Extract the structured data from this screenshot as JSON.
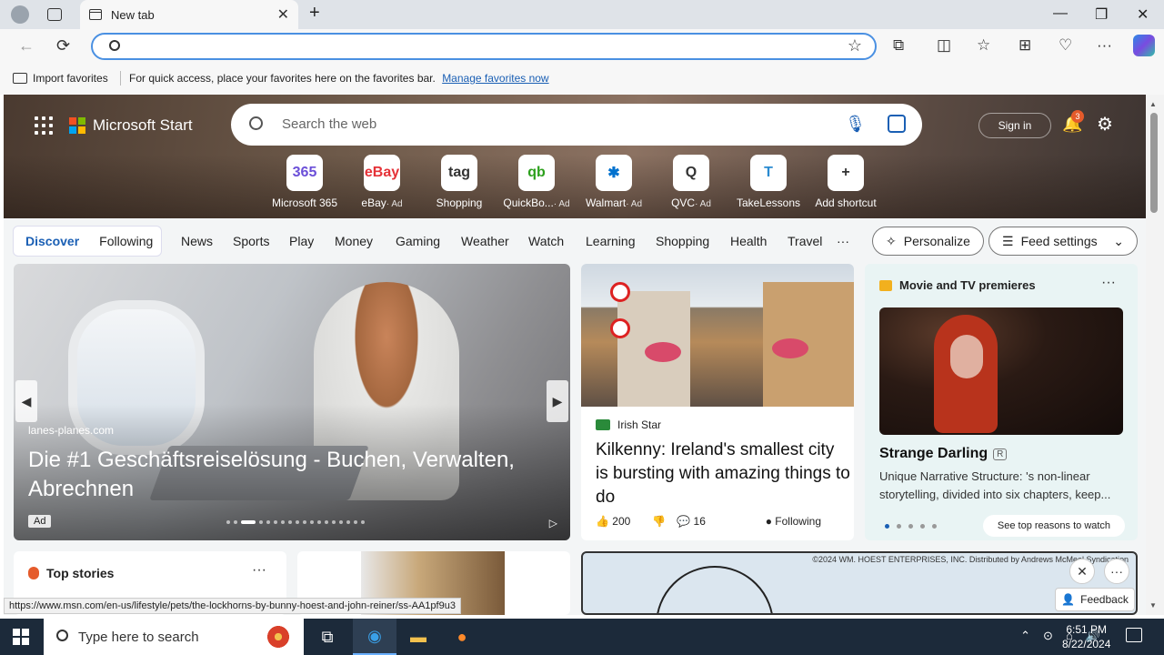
{
  "browser": {
    "tab_title": "New tab",
    "favbar": {
      "import_label": "Import favorites",
      "message": "For quick access, place your favorites here on the favorites bar.",
      "manage_link": "Manage favorites now"
    }
  },
  "header": {
    "brand": "Microsoft Start",
    "search_placeholder": "Search the web",
    "signin": "Sign in",
    "notification_count": "3"
  },
  "shortcuts": [
    {
      "label": "Microsoft 365",
      "ad": "",
      "icon": "365",
      "color": "#6b4fd8"
    },
    {
      "label": "eBay",
      "ad": "· Ad",
      "icon": "eBay",
      "color": "#e53238"
    },
    {
      "label": "Shopping",
      "ad": "",
      "icon": "tag",
      "color": "#333"
    },
    {
      "label": "QuickBo...",
      "ad": "· Ad",
      "icon": "qb",
      "color": "#2ca01c"
    },
    {
      "label": "Walmart",
      "ad": "· Ad",
      "icon": "✱",
      "color": "#0071ce"
    },
    {
      "label": "QVC",
      "ad": "· Ad",
      "icon": "Q",
      "color": "#333"
    },
    {
      "label": "TakeLessons",
      "ad": "",
      "icon": "T",
      "color": "#2a8ad0"
    },
    {
      "label": "Add shortcut",
      "ad": "",
      "icon": "+",
      "color": "#333"
    }
  ],
  "nav": {
    "discover": "Discover",
    "following": "Following",
    "items": [
      "News",
      "Sports",
      "Play",
      "Money",
      "Gaming",
      "Weather",
      "Watch",
      "Learning",
      "Shopping",
      "Health",
      "Travel",
      "···"
    ],
    "personalize": "Personalize",
    "feed_settings": "Feed settings"
  },
  "hero_card": {
    "source": "lanes-planes.com",
    "title": "Die #1 Geschäftsreiselösung - Buchen, Verwalten, Abrechnen",
    "ad_tag": "Ad"
  },
  "news_card": {
    "publisher": "Irish Star",
    "title": "Kilkenny: Ireland's smallest city is bursting with amazing things to do",
    "likes": "200",
    "comments": "16",
    "following": "Following"
  },
  "movie_card": {
    "header": "Movie and TV premieres",
    "title": "Strange Darling",
    "rating": "R",
    "description": "Unique Narrative Structure: 's non-linear storytelling, divided into six chapters, keep...",
    "see_more": "See top reasons to watch"
  },
  "top_stories": {
    "header": "Top stories"
  },
  "comic_credit": "©2024 WM. HOEST ENTERPRISES, INC. Distributed by Andrews McMeel Syndication",
  "feedback": "Feedback",
  "status_url": "https://www.msn.com/en-us/lifestyle/pets/the-lockhorns-by-bunny-hoest-and-john-reiner/ss-AA1pf9u3",
  "taskbar": {
    "search_placeholder": "Type here to search",
    "time": "6:51 PM",
    "date": "8/22/2024"
  }
}
